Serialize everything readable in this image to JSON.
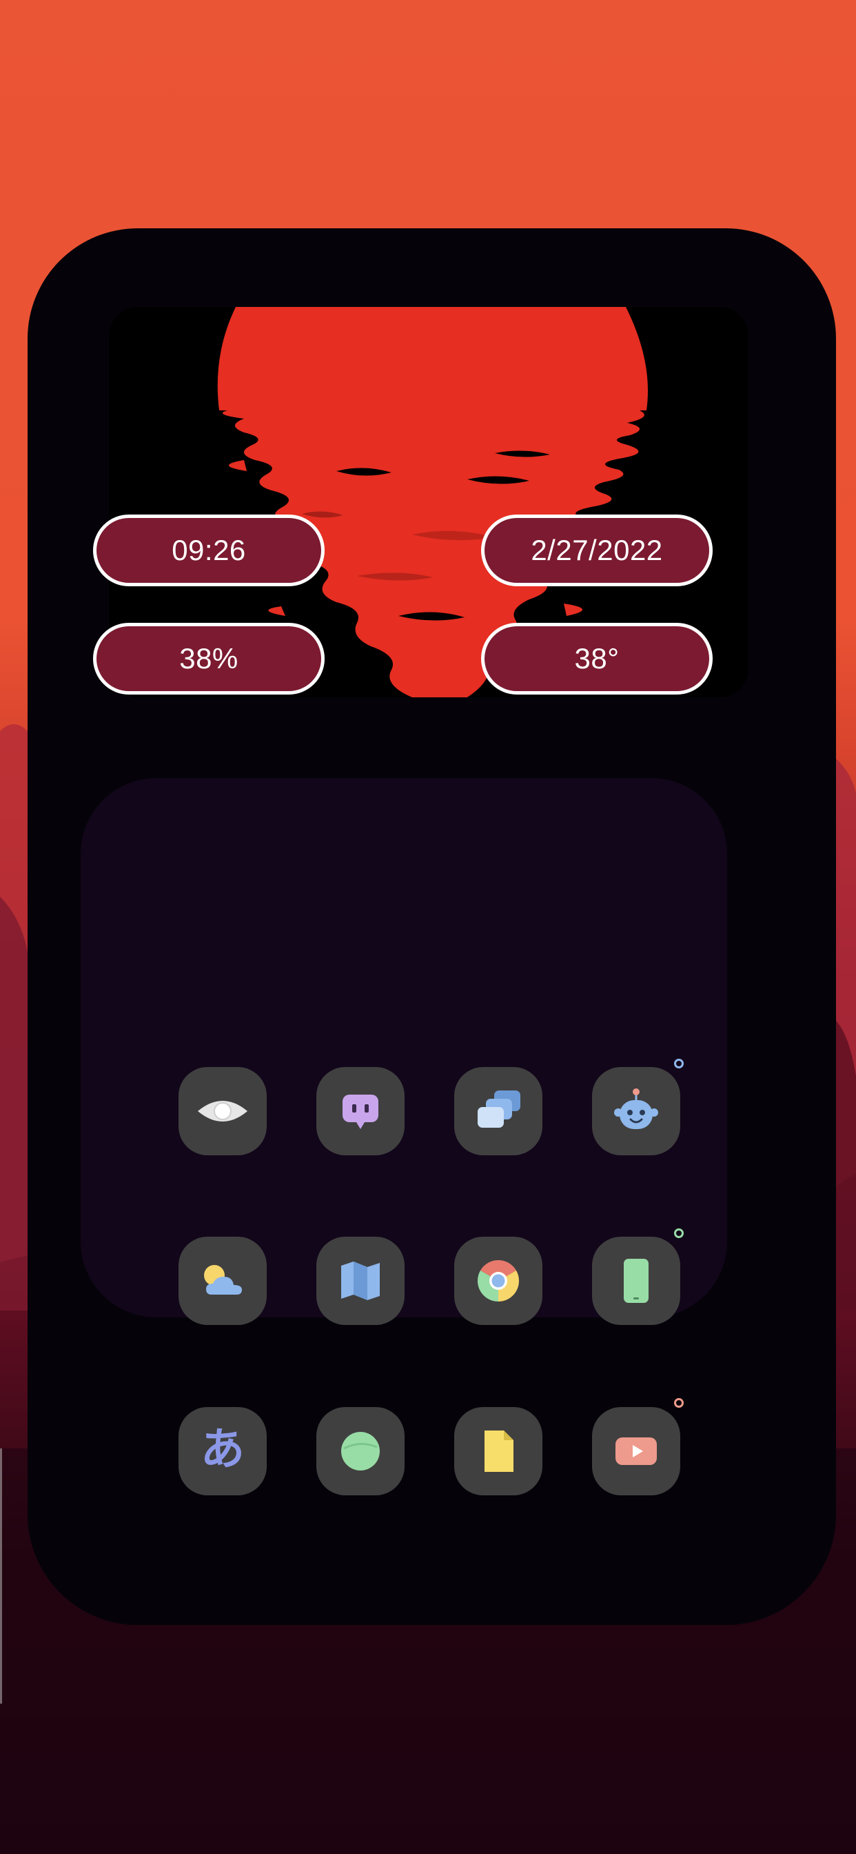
{
  "widgets": {
    "time": "09:26",
    "date": "2/27/2022",
    "battery": "38%",
    "temperature": "38°"
  },
  "colors": {
    "wallpaper_top": "#ea5535",
    "wallpaper_bottom": "#1c0410",
    "card_background": "#050309",
    "pill_fill": "#7b1a30",
    "pill_border": "#ffffff",
    "sun_red": "#e62e22",
    "dock_background": "#12061a",
    "icon_tile": "#404040"
  },
  "apps": [
    {
      "name": "eye-app-icon",
      "color": "#e6e6e6"
    },
    {
      "name": "chat-app-icon",
      "color": "#c9a6ec"
    },
    {
      "name": "gallery-app-icon",
      "color": "#8fb8ec"
    },
    {
      "name": "robot-app-icon",
      "color": "#8fb8ec"
    },
    {
      "name": "weather-app-icon",
      "color": "#f7d66b"
    },
    {
      "name": "maps-app-icon",
      "color": "#8fb8ec"
    },
    {
      "name": "chrome-app-icon",
      "color": "#e77a6c"
    },
    {
      "name": "phone-app-icon",
      "color": "#98dca6"
    },
    {
      "name": "japanese-keyboard-app-icon",
      "color": "#8b98e8",
      "glyph": "あ"
    },
    {
      "name": "circle-app-icon",
      "color": "#98dca6"
    },
    {
      "name": "notes-app-icon",
      "color": "#f7dd6a"
    },
    {
      "name": "youtube-app-icon",
      "color": "#ee9a8c"
    }
  ],
  "row_indicators": [
    {
      "color": "#8fb8ec"
    },
    {
      "color": "#98dca6"
    },
    {
      "color": "#ee9a8c"
    }
  ]
}
